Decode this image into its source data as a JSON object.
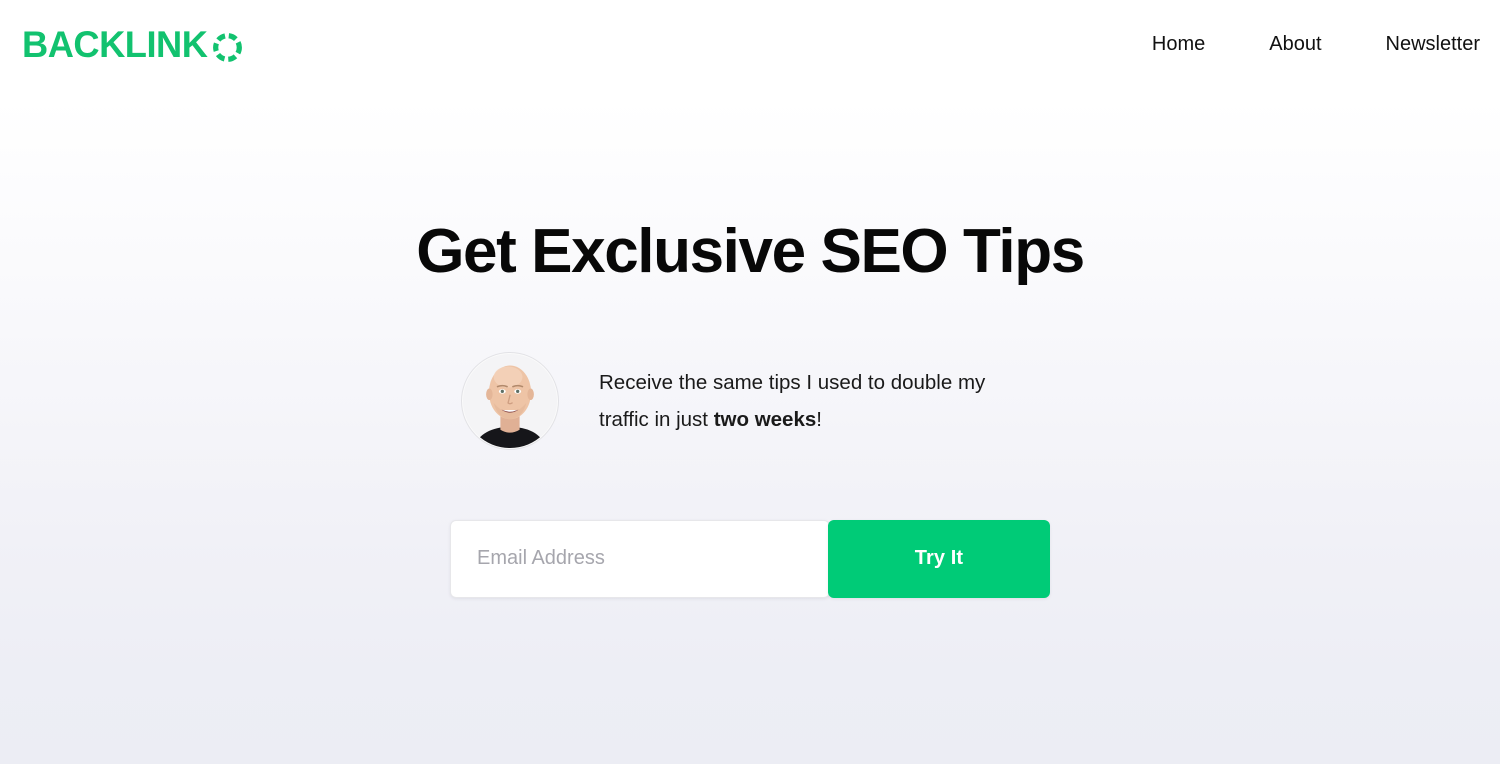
{
  "brand": {
    "wordmark": "BACKLINK",
    "ring_icon": "dashed-ring-icon",
    "full_name": "BACKLINKO",
    "color": "#12c26f"
  },
  "nav": {
    "items": [
      {
        "label": "Home",
        "name": "nav-link-home"
      },
      {
        "label": "About",
        "name": "nav-link-about"
      },
      {
        "label": "Newsletter",
        "name": "nav-link-newsletter"
      }
    ]
  },
  "hero": {
    "title": "Get Exclusive SEO Tips",
    "avatar_alt": "avatar-photo",
    "pitch": {
      "lead": "Receive the same tips I used to double my traffic in just ",
      "emphasis": "two weeks",
      "tail": "!"
    }
  },
  "form": {
    "email_placeholder": "Email Address",
    "email_value": "",
    "submit_label": "Try It",
    "accent_color": "#00cb77"
  },
  "theme": {
    "background_top": "#ffffff",
    "background_bottom": "#ecedf4",
    "text_color": "#111111",
    "placeholder_color": "#a6a6ad"
  }
}
